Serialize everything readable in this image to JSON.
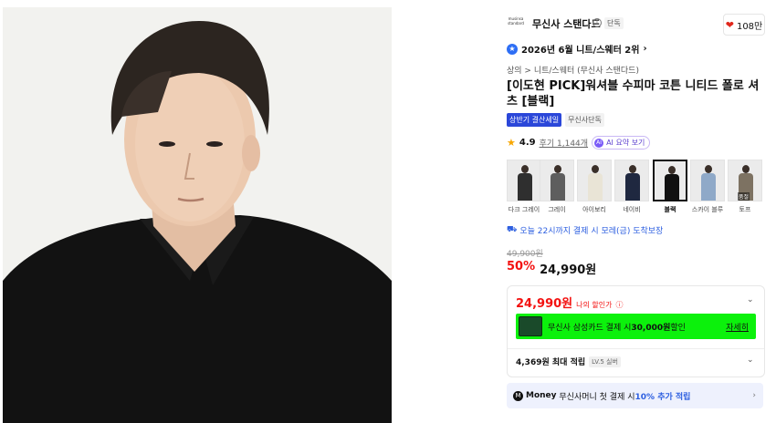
{
  "brand": {
    "logo_text": "musinsa standard",
    "name": "무신사 스탠다드",
    "exclusive": "단독",
    "like_count": "108만"
  },
  "ranking": {
    "text": "2026년 6월 니트/스웨터 2위"
  },
  "breadcrumb": "상의 > 니트/스웨터 (무신사 스탠다드)",
  "product": {
    "title": "[이도현 PICK]워셔블 수피마 코튼 니티드 폴로 셔츠 [블랙]"
  },
  "tags": [
    "상반기 결산세일",
    "무신사단독"
  ],
  "rating": {
    "score": "4.9",
    "reviews": "후기 1,144개",
    "ai": "AI 요약 보기"
  },
  "colors": [
    {
      "label": "다크 그레이",
      "tone": "#2f2f2f",
      "selected": false
    },
    {
      "label": "그레이",
      "tone": "#5e5e5e",
      "selected": false
    },
    {
      "label": "아이보리",
      "tone": "#e9e4d6",
      "selected": false
    },
    {
      "label": "네이비",
      "tone": "#1f2840",
      "selected": false
    },
    {
      "label": "블랙",
      "tone": "#111111",
      "selected": true
    },
    {
      "label": "스카이 블루",
      "tone": "#8fa9c8",
      "selected": false
    },
    {
      "label": "토프",
      "tone": "#7d7262",
      "selected": false,
      "soldout": "품절"
    }
  ],
  "delivery": "오늘 22시까지 결제 시 모레(금) 도착보장",
  "pricing": {
    "original": "49,900원",
    "discount": "50%",
    "price": "24,990원"
  },
  "my_price": {
    "value": "24,990원",
    "label": "나의 할인가"
  },
  "card_promo": {
    "text_prefix": "무신사 삼성카드 결제 시 ",
    "amount": "30,000원",
    "text_suffix": " 할인",
    "detail": "자세히"
  },
  "points": {
    "text": "4,369원 최대 적립",
    "level": "LV.5 실버"
  },
  "money": {
    "logo": "M",
    "brand": "Money",
    "text": "무신사머니 첫 결제 시 ",
    "accent": "10% 추가 적립"
  },
  "colors_theme": {
    "accent_red": "#f31110",
    "accent_blue": "#2d5fe0",
    "promo_green": "#0cf10c"
  }
}
